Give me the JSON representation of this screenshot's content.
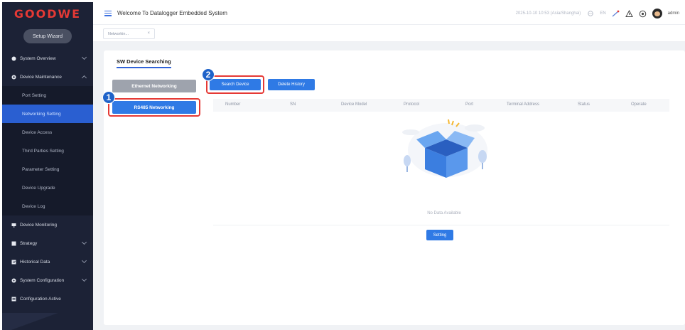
{
  "sidebar": {
    "logo": "GOODWE",
    "setup_wizard": "Setup Wizard",
    "items": [
      {
        "label": "System Overview"
      },
      {
        "label": "Device Maintenance"
      },
      {
        "label": "Device Monitoring"
      },
      {
        "label": "Strategy"
      },
      {
        "label": "Historical Data"
      },
      {
        "label": "System Configuration"
      },
      {
        "label": "Configuration Active"
      }
    ],
    "submenu": [
      {
        "label": "Port Setting"
      },
      {
        "label": "Networking Setting"
      },
      {
        "label": "Device Access"
      },
      {
        "label": "Third Parties Setting"
      },
      {
        "label": "Parameter Setting"
      },
      {
        "label": "Device Upgrade"
      },
      {
        "label": "Device Log"
      }
    ]
  },
  "header": {
    "welcome": "Welcome To Datalogger Embedded System",
    "datetime": "2025-10-10 10:53 (Asia/Shanghai)",
    "lang": "EN",
    "user": "admin"
  },
  "tabs": [
    {
      "label": "Networkin..."
    }
  ],
  "main": {
    "title": "SW Device Searching",
    "ethernet_networking": "Ethernet Networking",
    "rs485_networking": "RS485 Networking",
    "search_device": "Search Device",
    "delete_history": "Delete History",
    "badge1": "1",
    "badge2": "2",
    "table": {
      "columns": [
        "Number",
        "SN",
        "Device Model",
        "Protocol",
        "Port",
        "Terminal Address",
        "Status",
        "Operate"
      ]
    },
    "empty_text": "No Data Available",
    "setting": "Setting"
  },
  "colors": {
    "sidebar_bg": "#1c2236",
    "active_blue": "#2a5fd1",
    "button_blue": "#2f7ae5",
    "highlight_red": "#e53935",
    "logo_red": "#e53935"
  }
}
